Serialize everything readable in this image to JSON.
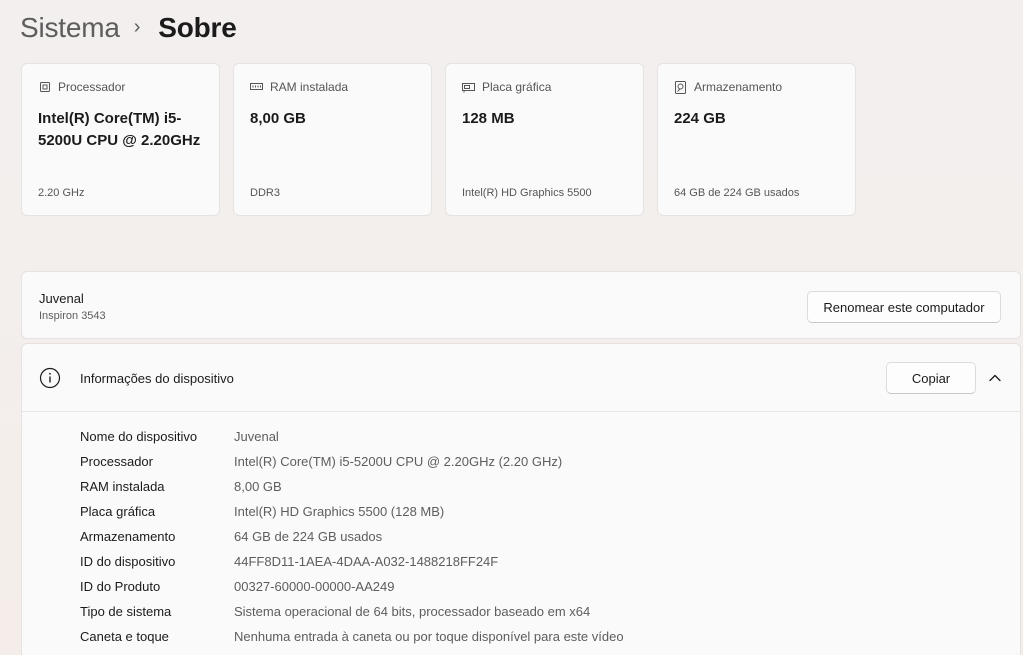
{
  "breadcrumb": {
    "parent": "Sistema",
    "separator": "›",
    "current": "Sobre"
  },
  "spec_cards": [
    {
      "icon": "processor-chip-icon",
      "label": "Processador",
      "value": "Intel(R) Core(TM) i5-5200U CPU @ 2.20GHz",
      "detail": "2.20 GHz"
    },
    {
      "icon": "ram-module-icon",
      "label": "RAM instalada",
      "value": "8,00 GB",
      "detail": "DDR3"
    },
    {
      "icon": "graphics-card-icon",
      "label": "Placa gráfica",
      "value": "128 MB",
      "detail": "Intel(R) HD Graphics 5500"
    },
    {
      "icon": "storage-drive-icon",
      "label": "Armazenamento",
      "value": "224 GB",
      "detail": "64 GB de 224 GB usados"
    }
  ],
  "computer": {
    "name": "Juvenal",
    "model": "Inspiron 3543",
    "rename_label": "Renomear este computador"
  },
  "device_info": {
    "icon": "info-icon",
    "title": "Informações do dispositivo",
    "copy_label": "Copiar",
    "collapse_icon": "chevron-up-icon",
    "rows": [
      {
        "label": "Nome do dispositivo",
        "value": "Juvenal"
      },
      {
        "label": "Processador",
        "value": "Intel(R) Core(TM) i5-5200U CPU @ 2.20GHz (2.20 GHz)"
      },
      {
        "label": "RAM instalada",
        "value": "8,00 GB"
      },
      {
        "label": "Placa gráfica",
        "value": "Intel(R) HD Graphics 5500 (128 MB)"
      },
      {
        "label": "Armazenamento",
        "value": "64 GB de 224 GB usados"
      },
      {
        "label": "ID do dispositivo",
        "value": "44FF8D11-1AEA-4DAA-A032-1488218FF24F"
      },
      {
        "label": "ID do Produto",
        "value": "00327-60000-00000-AA249"
      },
      {
        "label": "Tipo de sistema",
        "value": "Sistema operacional de 64 bits, processador baseado em x64"
      },
      {
        "label": "Caneta e toque",
        "value": "Nenhuma entrada à caneta ou por toque disponível para este vídeo"
      }
    ]
  }
}
